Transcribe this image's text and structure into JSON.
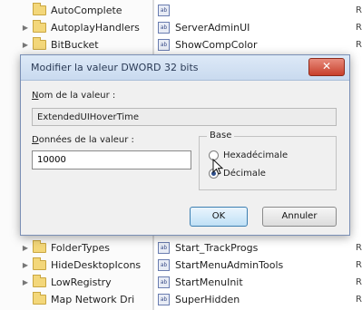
{
  "tree": {
    "items_top": [
      {
        "label": "AutoComplete",
        "expander": ""
      },
      {
        "label": "AutoplayHandlers",
        "expander": "▶"
      },
      {
        "label": "BitBucket",
        "expander": "▶"
      }
    ],
    "items_bottom": [
      {
        "label": "FolderTypes",
        "expander": "▶"
      },
      {
        "label": "HideDesktopIcons",
        "expander": "▶"
      },
      {
        "label": "LowRegistry",
        "expander": "▶"
      },
      {
        "label": "Map Network Dri",
        "expander": ""
      }
    ]
  },
  "values": {
    "items_top": [
      {
        "name": "",
        "type": "R"
      },
      {
        "name": "ServerAdminUI",
        "type": "R"
      },
      {
        "name": "ShowCompColor",
        "type": "R"
      }
    ],
    "items_bottom": [
      {
        "name": "Start_TrackProgs",
        "type": "R"
      },
      {
        "name": "StartMenuAdminTools",
        "type": "R"
      },
      {
        "name": "StartMenuInit",
        "type": "R"
      },
      {
        "name": "SuperHidden",
        "type": "R"
      }
    ],
    "icon_text": "ab"
  },
  "dialog": {
    "title": "Modifier la valeur DWORD 32 bits",
    "close_label": "✕",
    "value_name_label_u": "N",
    "value_name_label_rest": "om de la valeur :",
    "value_name": "ExtendedUIHoverTime",
    "value_data_label_u": "D",
    "value_data_label_rest": "onnées de la valeur :",
    "value_data": "10000",
    "base_label": "Base",
    "radio_hex_label": "Hexadécimale",
    "radio_dec_label": "Décimale",
    "selected_base": "decimal",
    "ok_label": "OK",
    "cancel_label": "Annuler"
  }
}
